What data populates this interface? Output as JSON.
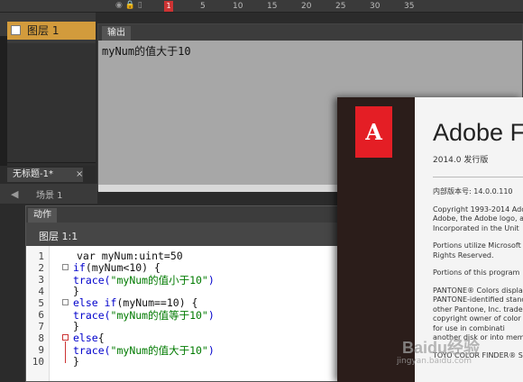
{
  "timeline": {
    "frame_labels": [
      "1",
      "5",
      "10",
      "15",
      "20",
      "25",
      "30",
      "35"
    ],
    "playhead": "1"
  },
  "layers": {
    "layer_name": "图层 1"
  },
  "output_panel": {
    "tab_label": "输出",
    "text": "myNum的值大于10"
  },
  "document": {
    "tab_label": "无标题-1*",
    "close_label": "×",
    "scene_label": "场景 1"
  },
  "actions_panel": {
    "tab_label": "动作",
    "header": "图层 1:1",
    "line_numbers": [
      "1",
      "2",
      "3",
      "4",
      "5",
      "6",
      "7",
      "8",
      "9",
      "10"
    ],
    "code": {
      "l1": "var myNum:uint=50",
      "l2_kw": "if",
      "l2_rest": "(myNum<10) {",
      "l3_fn": "trace(",
      "l3_str": "\"myNum的值小于10\"",
      "l3_end": ")",
      "l4": "}",
      "l5_kw": "else if",
      "l5_rest": "(myNum==10) {",
      "l6_fn": "trace(",
      "l6_str": "\"myNum的值等于10\"",
      "l6_end": ")",
      "l7": "}",
      "l8_kw": "else",
      "l8_rest": "{",
      "l9_fn": "trace(",
      "l9_str": "\"myNum的值大于10\"",
      "l9_end": ")",
      "l10": "}"
    }
  },
  "splash": {
    "logo": "A",
    "title": "Adobe F",
    "version": "2014.0 发行版",
    "build": "内部版本号: 14.0.0.110",
    "copyright": [
      "Copyright 1993-2014 Ado",
      "Adobe, the Adobe logo, a",
      "Incorporated in the Unit"
    ],
    "portions1": [
      "Portions utilize Microsoft",
      "Rights Reserved."
    ],
    "portions2": [
      "Portions of this program"
    ],
    "pantone": [
      "PANTONE® Colors displa",
      "PANTONE-identified stand",
      "other Pantone, Inc. trade",
      "copyright owner of color",
      "for use in combinati",
      "another disk or into mem"
    ],
    "toyo": "TOYO COLOR FINDER® S"
  },
  "watermark": {
    "text": "Baidu经验",
    "sub": "jingyan.baidu.com"
  }
}
